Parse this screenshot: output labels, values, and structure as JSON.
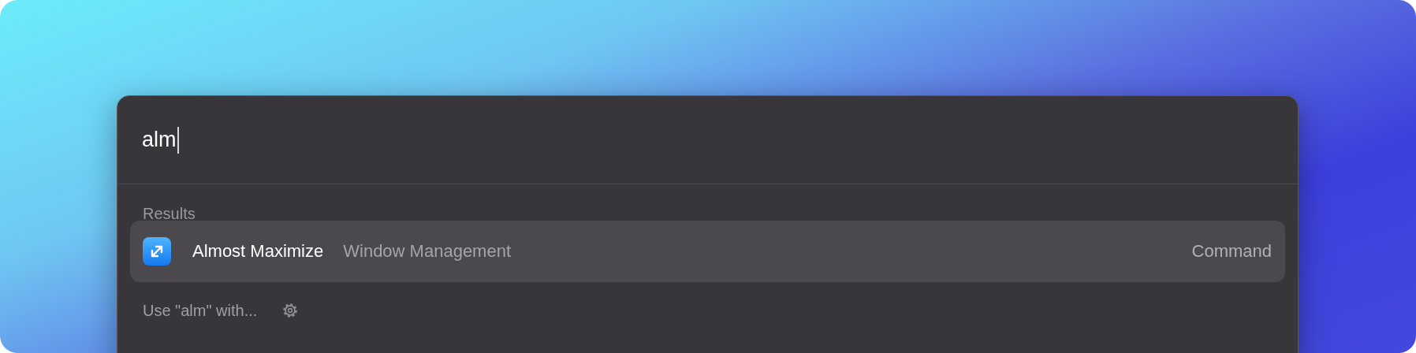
{
  "search": {
    "value": "alm"
  },
  "section_title": "Results",
  "results": [
    {
      "title": "Almost Maximize",
      "subtitle": "Window Management",
      "type": "Command",
      "selected": true
    }
  ],
  "fallback": {
    "label": "Use \"alm\" with..."
  }
}
